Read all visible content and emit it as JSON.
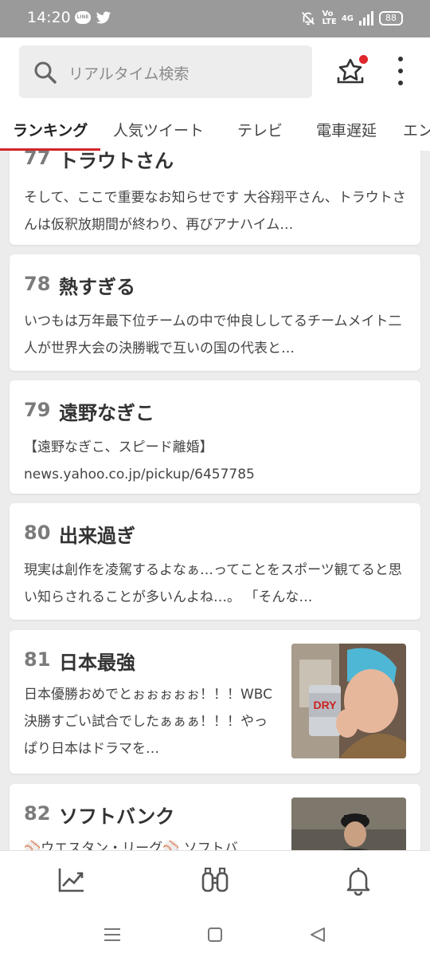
{
  "status_bar": {
    "time": "14:20",
    "line_badge": "LINE",
    "network_labels": [
      "Vo",
      "LTE",
      "4G"
    ],
    "battery": "88"
  },
  "search": {
    "placeholder": "リアルタイム検索"
  },
  "tabs": [
    {
      "label": "ランキング",
      "active": true
    },
    {
      "label": "人気ツイート"
    },
    {
      "label": "テレビ"
    },
    {
      "label": "電車遅延"
    },
    {
      "label": "エン"
    }
  ],
  "cards": [
    {
      "rank": "77",
      "word": "トラウトさん",
      "snippet": "そして、ここで重要なお知らせです 大谷翔平さん、トラウトさんは仮釈放期間が終わり、再びアナハイム…"
    },
    {
      "rank": "78",
      "word": "熱すぎる",
      "snippet": "いつもは万年最下位チームの中で仲良ししてるチームメイト二人が世界大会の決勝戦で互いの国の代表と…"
    },
    {
      "rank": "79",
      "word": "遠野なぎこ",
      "snippet": "【遠野なぎこ、スピード離婚】 news.yahoo.co.jp/pickup/6457785"
    },
    {
      "rank": "80",
      "word": "出来過ぎ",
      "snippet": "現実は創作を凌駕するよなぁ…ってことをスポーツ観てると思い知らされることが多いんよね…。 「そんな…"
    },
    {
      "rank": "81",
      "word": "日本最強",
      "snippet": "日本優勝おめでとぉぉぉぉぉ！！！WBC決勝すごい試合でしたぁぁぁ！！！やっぱり日本はドラマを…",
      "image_text": "DRY"
    },
    {
      "rank": "82",
      "word": "ソフトバンク",
      "snippet": "⚾ウエスタン・リーグ⚾ ソフトバ"
    }
  ],
  "colors": {
    "accent": "#d1262a",
    "status_bar": "#9a9a9a",
    "background": "#ececec"
  },
  "icons": [
    "search-icon",
    "star-tray-icon",
    "more-vert-icon",
    "trending-chart-icon",
    "binoculars-icon",
    "bell-icon",
    "recent-apps-icon",
    "home-square-icon",
    "back-triangle-icon"
  ]
}
